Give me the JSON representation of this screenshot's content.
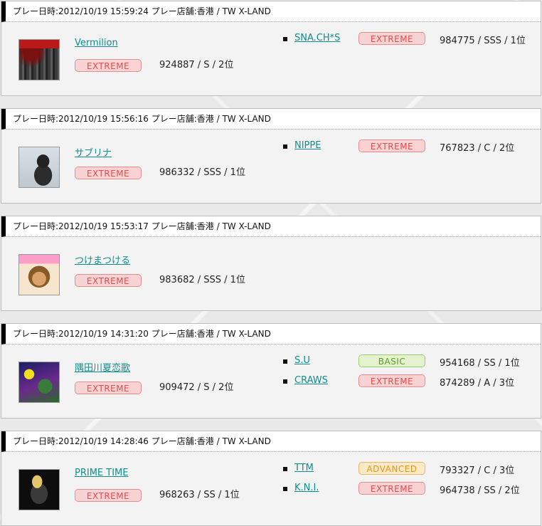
{
  "records": [
    {
      "header": {
        "label": "プレー日時:",
        "datetime": "2012/10/19 15:59:24",
        "store_label": "プレー店舗:",
        "store": "香港 / TW  X-LAND"
      },
      "jacket_icon": "vermilion-jacket",
      "song": "Vermilion",
      "difficulty": "EXTREME",
      "score": "924887 / S / 2位",
      "rivals": [
        {
          "name": "SNA.CH*S",
          "difficulty": "EXTREME",
          "score": "984775 / SSS / 1位"
        }
      ]
    },
    {
      "header": {
        "label": "プレー日時:",
        "datetime": "2012/10/19 15:56:16",
        "store_label": "プレー店舗:",
        "store": "香港 / TW  X-LAND"
      },
      "jacket_icon": "sabrina-jacket",
      "song": "サブリナ",
      "difficulty": "EXTREME",
      "score": "986332 / SSS / 1位",
      "rivals": [
        {
          "name": "NIPPE",
          "difficulty": "EXTREME",
          "score": "767823 / C / 2位"
        }
      ]
    },
    {
      "header": {
        "label": "プレー日時:",
        "datetime": "2012/10/19 15:53:17",
        "store_label": "プレー店舗:",
        "store": "香港 / TW  X-LAND"
      },
      "jacket_icon": "tsukematsukeru-jacket",
      "song": "つけまつける",
      "difficulty": "EXTREME",
      "score": "983682 / SSS / 1位",
      "rivals": []
    },
    {
      "header": {
        "label": "プレー日時:",
        "datetime": "2012/10/19 14:31:20",
        "store_label": "プレー店舗:",
        "store": "香港 / TW  X-LAND"
      },
      "jacket_icon": "sumidagawa-jacket",
      "song": "隅田川夏恋歌",
      "difficulty": "EXTREME",
      "score": "909472 / S / 2位",
      "rivals": [
        {
          "name": "S.U",
          "difficulty": "BASIC",
          "score": "954168 / SS / 1位"
        },
        {
          "name": "CRAWS",
          "difficulty": "EXTREME",
          "score": "874289 / A / 3位"
        }
      ]
    },
    {
      "header": {
        "label": "プレー日時:",
        "datetime": "2012/10/19 14:28:46",
        "store_label": "プレー店舗:",
        "store": "香港 / TW  X-LAND"
      },
      "jacket_icon": "prime-time-jacket",
      "song": "PRIME TIME",
      "difficulty": "EXTREME",
      "score": "968263 / SS / 1位",
      "rivals": [
        {
          "name": "TTM",
          "difficulty": "ADVANCED",
          "score": "793327 / C / 3位"
        },
        {
          "name": "K.N.I.",
          "difficulty": "EXTREME",
          "score": "964738 / SS / 2位"
        }
      ]
    }
  ],
  "colors": {
    "extreme": "#e34c4c",
    "basic": "#5d9a22",
    "advanced": "#ea9616",
    "link": "#0f8e8e"
  }
}
